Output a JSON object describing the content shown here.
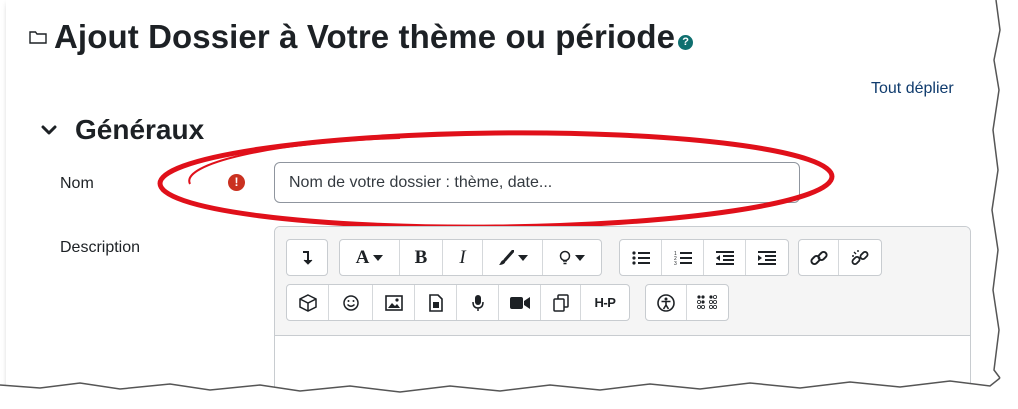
{
  "page": {
    "title": "Ajout Dossier à Votre thème ou période",
    "help_glyph": "?",
    "expand_all": "Tout déplier"
  },
  "section": {
    "title": "Généraux"
  },
  "form": {
    "name_label": "Nom",
    "name_required_glyph": "!",
    "name_placeholder": "Nom de votre dossier : thème, date...",
    "name_value": "",
    "description_label": "Description"
  },
  "editor": {
    "toolbar_row1": [
      [
        "collapse-toggle"
      ],
      [
        "font-color",
        "bold",
        "italic",
        "paint-brush",
        "lightbulb"
      ],
      [
        "unordered-list",
        "ordered-list",
        "outdent",
        "indent"
      ],
      [
        "link",
        "unlink"
      ]
    ],
    "toolbar_row2": [
      [
        "block-content",
        "emoji",
        "image",
        "media-document",
        "microphone",
        "video-camera",
        "copy",
        "h5p"
      ],
      [
        "accessibility-checker",
        "screen-reader-helper"
      ]
    ],
    "bold_glyph": "B",
    "italic_glyph": "I",
    "font_glyph": "A",
    "h5p_glyph": "H-P"
  },
  "colors": {
    "highlight": "#e0101a",
    "required": "#ca3120",
    "help": "#0f6f6f",
    "link": "#0f3b6d"
  }
}
